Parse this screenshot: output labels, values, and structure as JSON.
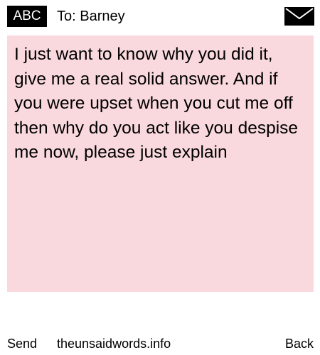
{
  "header": {
    "mode_badge": "ABC",
    "recipient": "To: Barney",
    "icon": "envelope-icon"
  },
  "message": {
    "text": "I just want to know why you did it, give me a real solid answer. And if you were upset when you cut me off then why do you act like you despise me now, please just explain",
    "background": "#f9d9dd"
  },
  "footer": {
    "left_label": "Send",
    "center_label": "theunsaidwords.info",
    "right_label": "Back"
  }
}
